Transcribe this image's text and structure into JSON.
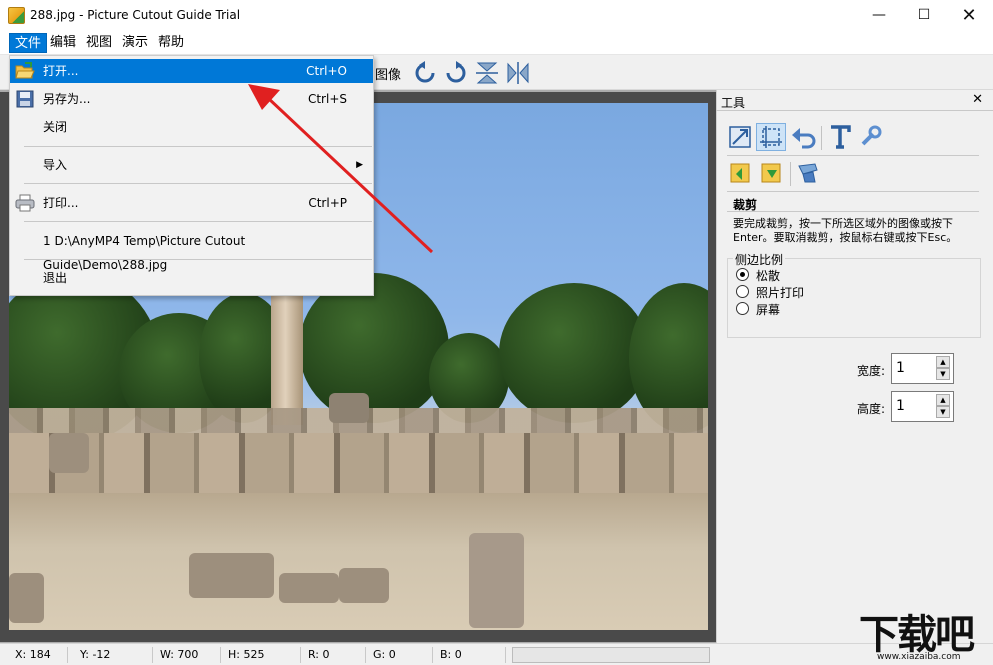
{
  "window": {
    "title": "288.jpg - Picture Cutout Guide Trial",
    "minimize": "—",
    "maximize": "☐",
    "close": "✕"
  },
  "menubar": {
    "items": [
      "文件",
      "编辑",
      "视图",
      "演示",
      "帮助"
    ]
  },
  "toolbar": {
    "label": "图像"
  },
  "file_menu": {
    "open": {
      "label": "打开...",
      "shortcut": "Ctrl+O"
    },
    "save_as": {
      "label": "另存为...",
      "shortcut": "Ctrl+S"
    },
    "close": {
      "label": "关闭"
    },
    "import": {
      "label": "导入",
      "arrow": "▶"
    },
    "print": {
      "label": "打印...",
      "shortcut": "Ctrl+P"
    },
    "recent": {
      "label": "1 D:\\AnyMP4 Temp\\Picture Cutout Guide\\Demo\\288.jpg"
    },
    "exit": {
      "label": "退出"
    }
  },
  "tool_panel": {
    "title": "工具",
    "close": "✕",
    "section_title": "裁剪",
    "description": "要完成裁剪，按一下所选区域外的图像或按下Enter。要取消裁剪，按鼠标右键或按下Esc。",
    "ratio_group": {
      "title": "侧边比例",
      "options": [
        {
          "label": "松散",
          "checked": true
        },
        {
          "label": "照片打印",
          "checked": false
        },
        {
          "label": "屏幕",
          "checked": false
        }
      ]
    },
    "width": {
      "label": "宽度:",
      "value": "1"
    },
    "height": {
      "label": "高度:",
      "value": "1"
    },
    "spin_up": "▲",
    "spin_down": "▼"
  },
  "statusbar": {
    "x": "X: 184",
    "y": "Y: -12",
    "w": "W: 700",
    "h": "H: 525",
    "r": "R: 0",
    "g": "G: 0",
    "b": "B: 0"
  },
  "watermark": {
    "big": "下载吧",
    "small": "www.xiazaiba.com"
  },
  "colors": {
    "accent": "#0078d7",
    "arrow": "#e02020"
  }
}
